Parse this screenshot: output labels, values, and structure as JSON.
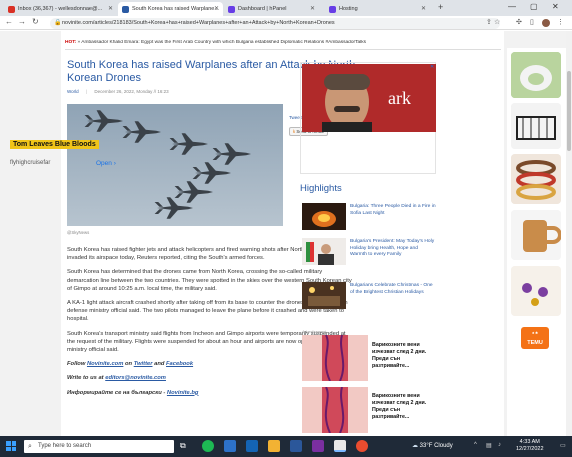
{
  "tabs": [
    {
      "label": "Inbox (36,367) - wellesdonnae@...",
      "favicon_color": "#d93025"
    },
    {
      "label": "South Korea has raised Warplane...",
      "favicon_color": "#2a5aa3"
    },
    {
      "label": "Dashboard | hPanel",
      "favicon_color": "#673de6"
    },
    {
      "label": "Hosting",
      "favicon_color": "#673de6"
    }
  ],
  "address": {
    "url": "novinite.com/articles/218183/South+Korea+has+raised+Warplanes+after+an+Attack+by+North+Korean+Drones"
  },
  "hotbar": {
    "hot_label": "HOT:",
    "text": "» Ambassador Khalid Emara: Egypt was the First Arab Country with which Bulgaria established Diplomatic Relations #AmbassadorTalks"
  },
  "article": {
    "title": "South Korea has raised Warplanes after an Attack by North Korean Drones",
    "category": "World",
    "date": "December 26, 2022, Monday // 16:23",
    "credit": "@SkyNews",
    "tweet": "TweetShare",
    "kindle": "Send to Kindle",
    "paragraphs": [
      "South Korea has raised fighter jets and attack helicopters and fired warning shots after North Korean drones invaded its airspace today, Reuters reported, citing the South's armed forces.",
      "South Korea has determined that the drones came from North Korea, crossing the so-called military demarcation line between the two countries. They were spotted in the skies over the western South Korean city of Gimpo at around 10:25 a.m. local time, the military said.",
      "A KA-1 light attack aircraft crashed shortly after taking off from its base to counter the drones, a South Korean defense ministry official said. The two pilots managed to leave the plane before it crashed and were taken to hospital.",
      "South Korea's transport ministry said flights from Incheon and Gimpo airports were temporarily suspended at the request of the military. Flights were suspended for about an hour and airports are now operating again, a ministry official said."
    ],
    "follow_prefix": "Follow ",
    "follow_site": "Novinite.com",
    "follow_on": " on ",
    "follow_twitter": "Twitter",
    "follow_and": " and ",
    "follow_facebook": "Facebook",
    "write_prefix": "Write to us at ",
    "write_email": "editors@novinite.com",
    "bg_prefix": "Информирайте се на български - ",
    "bg_link": "Novinite.bg"
  },
  "ad": {
    "title": "Tom Leaves Blue Bloods",
    "site": "flyhighcruisefar",
    "open": "Open  ›",
    "img_text": "ark"
  },
  "highlights": {
    "heading": "Highlights",
    "items": [
      {
        "text": "Bulgaria: Three People Died in a Fire in Sofia Last Night"
      },
      {
        "text": "Bulgaria's President: May Today's Holy Holiday bring Health, Hope and Warmth to every Family"
      },
      {
        "text": "Bulgarians Celebrate Christmas - One of the Brightest Christian Holidays"
      }
    ]
  },
  "advertisement_label": "Advertisement",
  "bg_ads": [
    {
      "text": "Варикозните вени изчезват след 2 дни. Преди сън разтривайте..."
    },
    {
      "text": "Варикозните вени изчезват след 2 дни. Преди сън разтривайте..."
    }
  ],
  "temu": {
    "label": "TEMU"
  },
  "taskbar": {
    "search_placeholder": "Type here to search",
    "weather": "33°F  Cloudy",
    "time": "4:33 AM",
    "date": "12/27/2022"
  }
}
